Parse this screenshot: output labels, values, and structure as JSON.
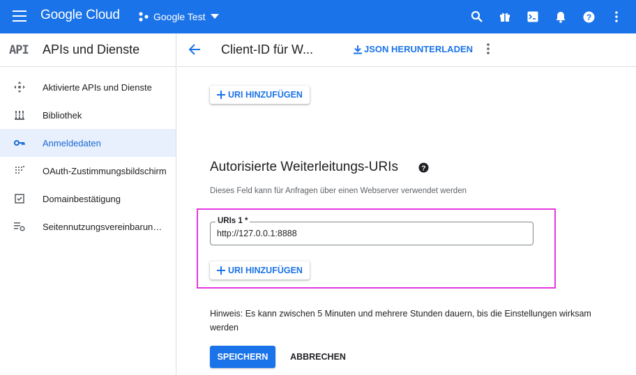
{
  "topbar": {
    "brand": "Google Cloud",
    "project": "Google Test",
    "icons": [
      "search-icon",
      "gift-icon",
      "terminal-icon",
      "bell-icon",
      "help-icon",
      "more-vert-icon"
    ]
  },
  "sidebar": {
    "logo": "API",
    "title": "APIs und Dienste",
    "items": [
      {
        "label": "Aktivierte APIs und Dienste",
        "icon": "move-arrows-icon",
        "active": false
      },
      {
        "label": "Bibliothek",
        "icon": "library-icon",
        "active": false
      },
      {
        "label": "Anmeldedaten",
        "icon": "key-icon",
        "active": true
      },
      {
        "label": "OAuth-Zustimmungsbildschirm",
        "icon": "consent-dots-icon",
        "active": false
      },
      {
        "label": "Domainbestätigung",
        "icon": "checkbox-icon",
        "active": false
      },
      {
        "label": "Seitennutzungsvereinbarungen",
        "icon": "settings-list-icon",
        "active": false
      }
    ]
  },
  "header": {
    "title": "Client-ID für W...",
    "json_button": "JSON HERUNTERLADEN"
  },
  "main": {
    "add_uri_top": "URI HINZUFÜGEN",
    "section_title": "Autorisierte Weiterleitungs-URIs",
    "section_desc": "Dieses Feld kann für Anfragen über einen Webserver verwendet werden",
    "field_label": "URIs 1 *",
    "field_value": "http://127.0.0.1:8888",
    "add_uri_bottom": "URI HINZUFÜGEN",
    "hint": "Hinweis: Es kann zwischen 5 Minuten und mehrere Stunden dauern, bis die Einstellungen wirksam werden",
    "save_label": "SPEICHERN",
    "cancel_label": "ABBRECHEN"
  },
  "colors": {
    "brand_blue": "#1a73e8",
    "active_bg": "#e8f0fe",
    "highlight": "#e536e0"
  }
}
